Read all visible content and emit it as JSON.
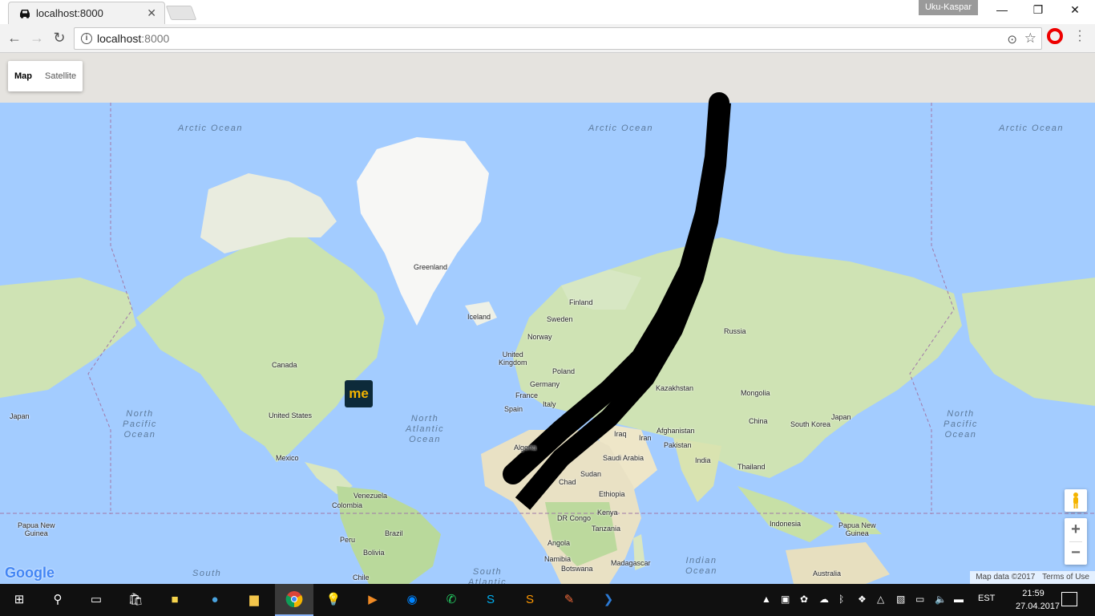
{
  "browser": {
    "tab_title": "localhost:8000",
    "tab_close": "✕",
    "user_name": "Uku-Kaspar",
    "url_host": "localhost",
    "url_port": ":8000",
    "minimize": "—",
    "restore": "❐",
    "close": "✕"
  },
  "map": {
    "type_control": {
      "map": "Map",
      "satellite": "Satellite"
    },
    "oceans": [
      "Arctic Ocean",
      "Arctic Ocean",
      "Arctic Ocean",
      "North\nPacific\nOcean",
      "North\nAtlantic\nOcean",
      "North\nPacific\nOcean",
      "South",
      "South\nAtlantic",
      "Indian\nOcean"
    ],
    "places": [
      "Greenland",
      "Iceland",
      "Finland",
      "Sweden",
      "Norway",
      "United\nKingdom",
      "Poland",
      "Germany",
      "France",
      "Spain",
      "Italy",
      "Russia",
      "Kazakhstan",
      "Mongolia",
      "China",
      "Japan",
      "South Korea",
      "Afghanistan",
      "Pakistan",
      "Iraq",
      "Iran",
      "India",
      "Thailand",
      "Saudi Arabia",
      "Algeria",
      "Chad",
      "Sudan",
      "Ethiopia",
      "Kenya",
      "DR Congo",
      "Tanzania",
      "Angola",
      "Namibia",
      "Botswana",
      "Madagascar",
      "Indonesia",
      "Papua New\nGuinea",
      "Papua New\nGuinea",
      "Australia",
      "Canada",
      "United States",
      "Mexico",
      "Venezuela",
      "Colombia",
      "Peru",
      "Brazil",
      "Bolivia",
      "Chile",
      "Japan"
    ],
    "marker_text": "me",
    "zoom_in": "+",
    "zoom_out": "−",
    "logo": "Google",
    "attribution": "Map data ©2017",
    "terms": "Terms of Use"
  },
  "taskbar": {
    "language": "EST",
    "time": "21:59",
    "date": "27.04.2017"
  }
}
